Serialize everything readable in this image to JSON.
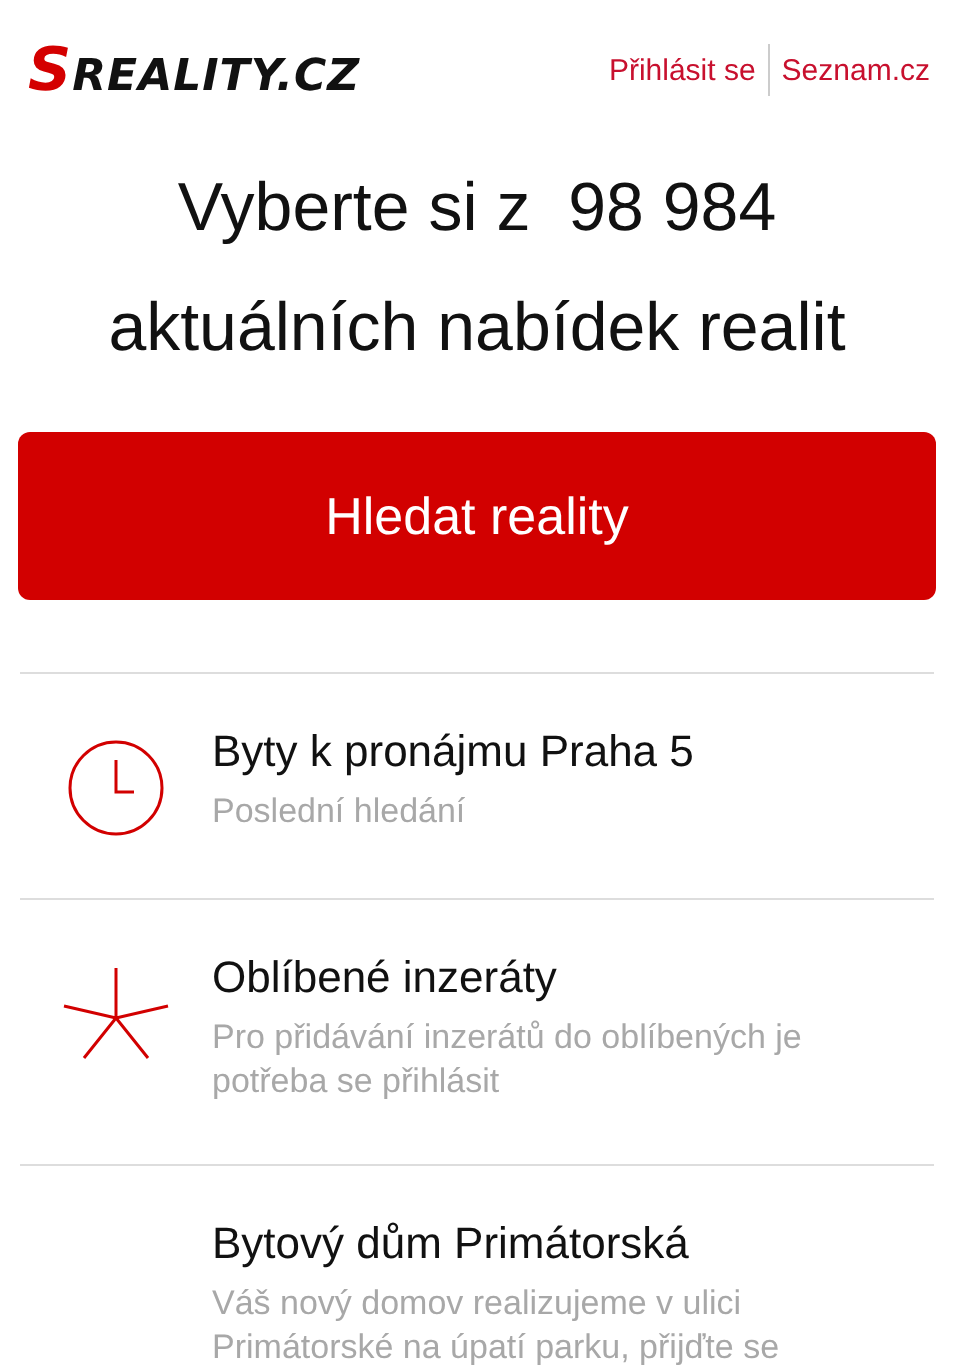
{
  "header": {
    "logo": {
      "initial": "S",
      "rest": "REALITY.CZ"
    },
    "links": [
      "Přihlásit se",
      "Seznam.cz"
    ]
  },
  "headline": [
    "Vyberte si z  98 984",
    "aktuálních nabídek realit"
  ],
  "search_button": "Hledat reality",
  "items": [
    {
      "kind": "clock",
      "title": "Byty k pronájmu Praha 5",
      "subtitle": "Poslední hledání"
    },
    {
      "kind": "star",
      "title": "Oblíbené inzeráty",
      "subtitle": "Pro přidávání inzerátů do oblíbených je potřeba se přihlásit"
    },
    {
      "kind": "none",
      "title": "Bytový dům Primátorská",
      "subtitle": "Váš nový domov realizujeme v ulici Primátorské na úpatí parku, přijďte se"
    }
  ]
}
